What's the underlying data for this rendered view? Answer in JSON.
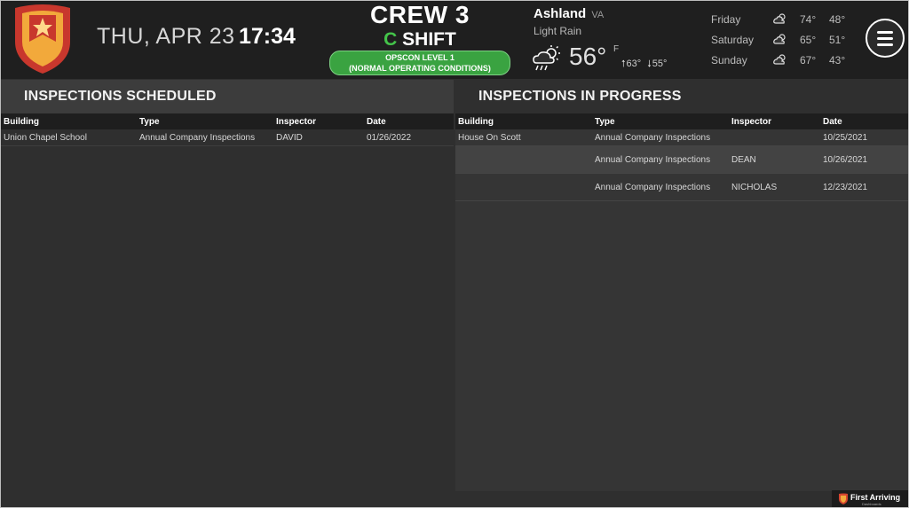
{
  "header": {
    "date": "THU, APR 23",
    "time": "17:34",
    "crew": "CREW 3",
    "shift_letter": "C",
    "shift_word": "SHIFT",
    "opscon_line1": "OPSCON LEVEL 1",
    "opscon_line2": "(NORMAL OPERATING CONDITIONS)"
  },
  "weather": {
    "city": "Ashland",
    "state": "VA",
    "condition": "Light Rain",
    "temp": "56°",
    "unit": "F",
    "high": "63°",
    "low": "55°",
    "current_icon": "rain-cloud-sun-icon",
    "forecast": [
      {
        "day": "Friday",
        "high": "74°",
        "low": "48°",
        "icon": "partly-cloudy-icon"
      },
      {
        "day": "Saturday",
        "high": "65°",
        "low": "51°",
        "icon": "partly-cloudy-icon"
      },
      {
        "day": "Sunday",
        "high": "67°",
        "low": "43°",
        "icon": "partly-cloudy-icon"
      }
    ]
  },
  "scheduled": {
    "title": "INSPECTIONS SCHEDULED",
    "columns": [
      "Building",
      "Type",
      "Inspector",
      "Date"
    ],
    "rows": [
      [
        "Union Chapel School",
        "Annual Company Inspections",
        "DAVID",
        "01/26/2022"
      ]
    ]
  },
  "in_progress": {
    "title": "INSPECTIONS IN PROGRESS",
    "columns": [
      "Building",
      "Type",
      "Inspector",
      "Date"
    ],
    "rows": [
      [
        "House On Scott",
        "Annual Company Inspections",
        "",
        "10/25/2021"
      ],
      [
        "",
        "Annual Company Inspections",
        "DEAN",
        "10/26/2021"
      ],
      [
        "",
        "Annual Company Inspections",
        "NICHOLAS",
        "12/23/2021"
      ]
    ]
  },
  "footer": {
    "brand": "First Arriving",
    "tagline": "Dashboards"
  },
  "colors": {
    "shift_accent": "#44c44a",
    "opscon_bg": "#3aa341",
    "logo_red": "#c8372d",
    "logo_gold": "#f2a93b"
  }
}
